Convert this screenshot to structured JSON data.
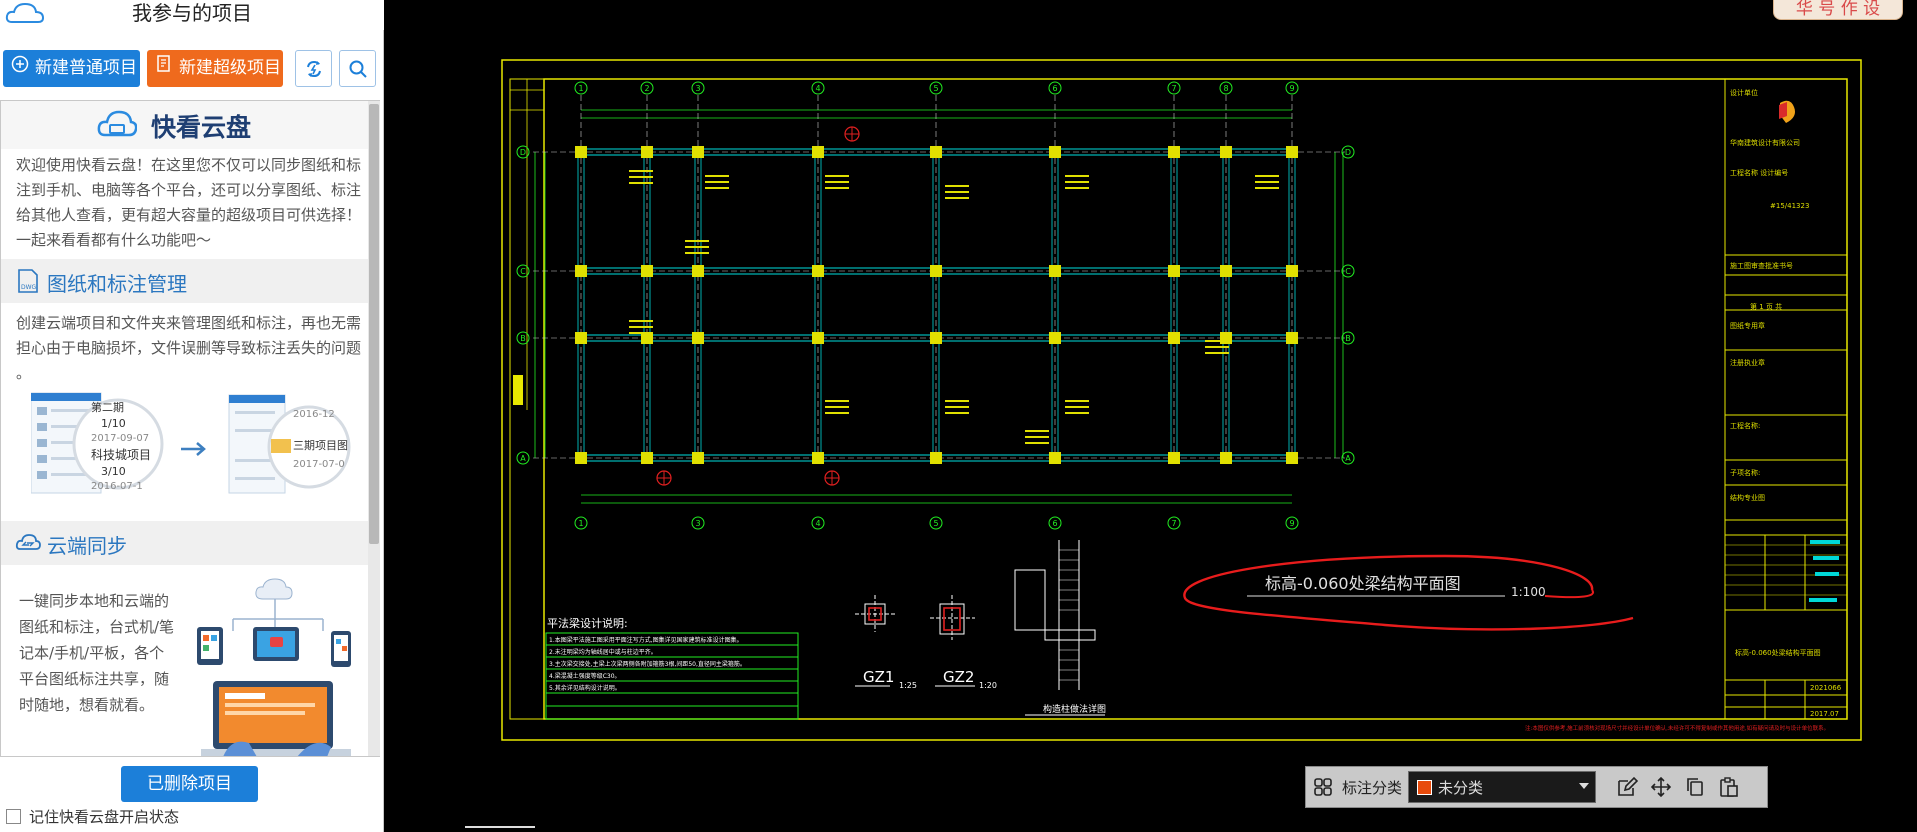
{
  "left_panel": {
    "title": "我参与的项目",
    "buttons": {
      "new_normal": "新建普通项目",
      "new_super": "新建超级项目"
    },
    "intro": {
      "heading": "快看云盘",
      "text": "欢迎使用快看云盘！在这里您不仅可以同步图纸和标注到手机、电脑等各个平台，还可以分享图纸、标注给其他人查看，更有超大容量的超级项目可供选择！一起来看看都有什么功能吧～"
    },
    "section1": {
      "heading": "图纸和标注管理",
      "text": "创建云端项目和文件夹来管理图纸和标注，再也无需担心由于电脑损坏，文件误删等导致标注丢失的问题 。",
      "illus": {
        "left_items": [
          "第二期",
          "1/10",
          "2017-09-07",
          "科技城项目",
          "3/10",
          "2016-07-1"
        ],
        "right_items": [
          "2016-12",
          "三期项目图",
          "2017-07-0"
        ]
      }
    },
    "section2": {
      "heading": "云端同步",
      "text": "一键同步本地和云端的图纸和标注，台式机/笔记本/手机/平板，各个平台图纸标注共享，随时随地，想看就看。"
    },
    "deleted_button": "已删除项目",
    "remember_label": "记住快看云盘开启状态"
  },
  "canvas": {
    "brand_logo_text": "华 号 作 设",
    "drawing": {
      "plan_title": "标高-0.060处梁结构平面图",
      "plan_scale": "1:100",
      "notes_title": "平法梁设计说明:",
      "col1_label": "GZ1",
      "col1_scale": "1:25",
      "col2_label": "GZ2",
      "col2_scale": "1:20",
      "section_caption": "构造柱做法详图",
      "grid_top": [
        "1",
        "2",
        "3",
        "4",
        "5",
        "6",
        "7",
        "8",
        "9"
      ],
      "grid_bottom": [
        "1",
        "3",
        "4",
        "5",
        "6",
        "7",
        "9"
      ],
      "grid_side": [
        "D",
        "C",
        "B",
        "A"
      ],
      "titleblock_num": "#15/41323",
      "titleblock_sheet": "第 1 页 共",
      "titleblock_drawing": "标高-0.060处梁结构平面图",
      "titleblock_date1": "2021066",
      "titleblock_date2": "2017.07"
    },
    "toolbar": {
      "category_label": "标注分类",
      "category_value": "未分类",
      "category_color": "#e84b0c"
    }
  }
}
